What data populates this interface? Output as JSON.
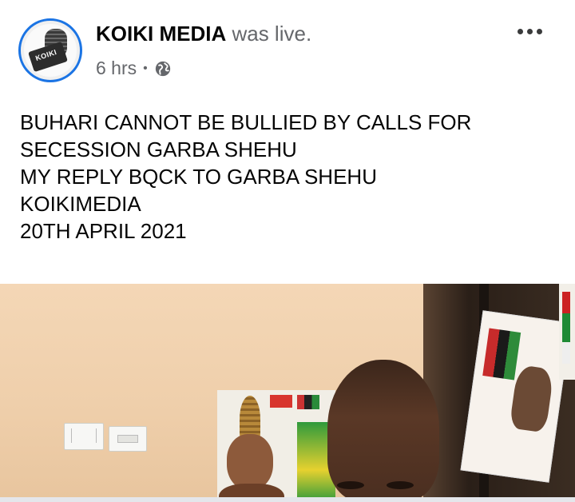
{
  "post": {
    "author": "KOIKI MEDIA",
    "action": "was live.",
    "time": "6 hrs",
    "separator": "•",
    "privacy_icon": "globe-icon",
    "more_icon": "more-horizontal-icon",
    "avatar_text": "KOIKI",
    "body_lines": [
      "BUHARI CANNOT BE BULLIED BY CALLS FOR",
      "SECESSION GARBA SHEHU",
      "MY REPLY BQCK TO GARBA SHEHU",
      "KOIKIMEDIA",
      "20TH APRIL 2021"
    ]
  },
  "colors": {
    "accent": "#1b74e4",
    "secondary_text": "#65676b",
    "primary_text": "#050505"
  }
}
